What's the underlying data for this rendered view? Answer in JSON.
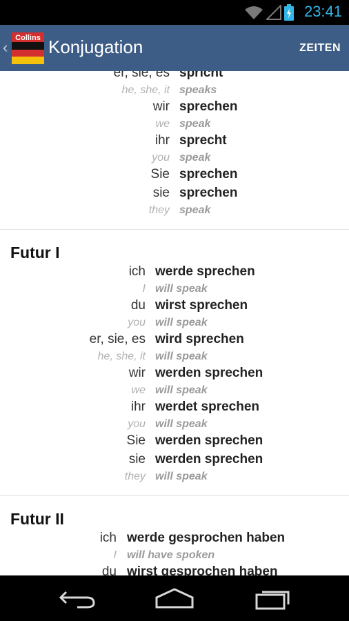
{
  "status_bar": {
    "time": "23:41"
  },
  "action_bar": {
    "back": "‹",
    "title": "Konjugation",
    "action": "ZEITEN",
    "logo_text": "Collins"
  },
  "sections": [
    {
      "title": "",
      "rows": [
        {
          "pronoun": "er, sie, es",
          "verb": "spricht",
          "trans_pronoun": "he, she, it",
          "trans_verb": "speaks"
        },
        {
          "pronoun": "wir",
          "verb": "sprechen",
          "trans_pronoun": "we",
          "trans_verb": "speak"
        },
        {
          "pronoun": "ihr",
          "verb": "sprecht",
          "trans_pronoun": "you",
          "trans_verb": "speak"
        },
        {
          "pronoun": "Sie",
          "verb": "sprechen"
        },
        {
          "pronoun": "sie",
          "verb": "sprechen",
          "trans_pronoun": "they",
          "trans_verb": "speak"
        }
      ]
    },
    {
      "title": "Futur I",
      "rows": [
        {
          "pronoun": "ich",
          "verb": "werde sprechen",
          "trans_pronoun": "I",
          "trans_verb": "will speak"
        },
        {
          "pronoun": "du",
          "verb": "wirst sprechen",
          "trans_pronoun": "you",
          "trans_verb": "will speak"
        },
        {
          "pronoun": "er, sie, es",
          "verb": "wird sprechen",
          "trans_pronoun": "he, she, it",
          "trans_verb": "will speak"
        },
        {
          "pronoun": "wir",
          "verb": "werden sprechen",
          "trans_pronoun": "we",
          "trans_verb": "will speak"
        },
        {
          "pronoun": "ihr",
          "verb": "werdet sprechen",
          "trans_pronoun": "you",
          "trans_verb": "will speak"
        },
        {
          "pronoun": "Sie",
          "verb": "werden sprechen"
        },
        {
          "pronoun": "sie",
          "verb": "werden sprechen",
          "trans_pronoun": "they",
          "trans_verb": "will speak"
        }
      ]
    },
    {
      "title": "Futur II",
      "rows": [
        {
          "pronoun": "ich",
          "verb": "werde gesprochen haben",
          "trans_pronoun": "I",
          "trans_verb": "will have spoken"
        },
        {
          "pronoun": "du",
          "verb": "wirst gesprochen haben"
        }
      ]
    }
  ],
  "nav_bar": {
    "back_icon": "back-icon",
    "home_icon": "home-icon",
    "recents_icon": "recents-icon"
  },
  "colors": {
    "action_bar": "#3d5d86",
    "status_accent": "#33b5e5"
  }
}
